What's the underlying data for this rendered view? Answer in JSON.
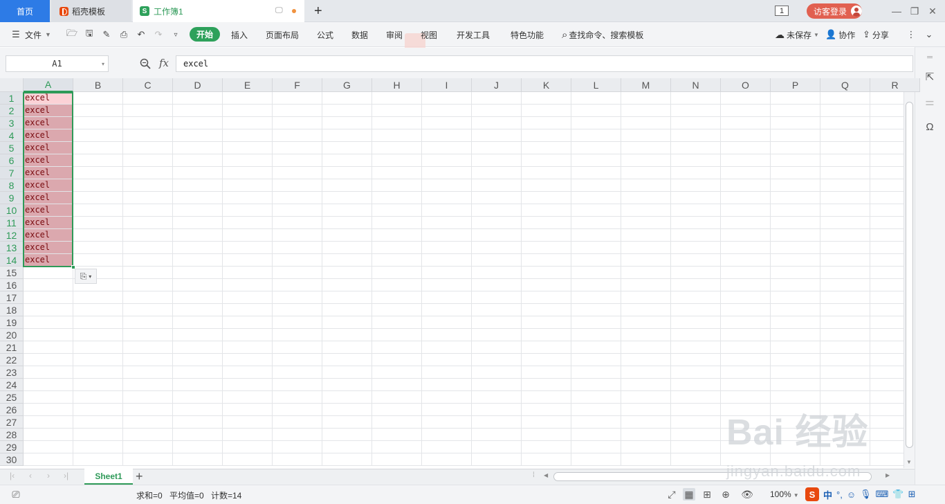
{
  "titlebar": {
    "tabs": [
      {
        "label": "首页"
      },
      {
        "label": "稻壳模板"
      },
      {
        "label": "工作簿1"
      }
    ],
    "window_count": "1",
    "login_label": "访客登录"
  },
  "menubar": {
    "file_label": "文件",
    "start_label": "开始",
    "items": [
      "插入",
      "页面布局",
      "公式",
      "数据",
      "审阅",
      "视图",
      "开发工具",
      "特色功能"
    ],
    "search_label": "查找命令、搜索模板",
    "unsaved_label": "未保存",
    "collab_label": "协作",
    "share_label": "分享"
  },
  "formulabar": {
    "name_box": "A1",
    "fx_label": "fx",
    "formula": "excel"
  },
  "grid": {
    "columns": [
      "A",
      "B",
      "C",
      "D",
      "E",
      "F",
      "G",
      "H",
      "I",
      "J",
      "K",
      "L",
      "M",
      "N",
      "O",
      "P",
      "Q",
      "R"
    ],
    "rows": [
      "1",
      "2",
      "3",
      "4",
      "5",
      "6",
      "7",
      "8",
      "9",
      "10",
      "11",
      "12",
      "13",
      "14",
      "15",
      "16",
      "17",
      "18",
      "19",
      "20",
      "21",
      "22",
      "23",
      "24",
      "25",
      "26",
      "27",
      "28",
      "29",
      "30"
    ],
    "col_a_values": [
      "excel",
      "excel",
      "excel",
      "excel",
      "excel",
      "excel",
      "excel",
      "excel",
      "excel",
      "excel",
      "excel",
      "excel",
      "excel",
      "excel"
    ]
  },
  "sheets": {
    "active": "Sheet1"
  },
  "statusbar": {
    "sum": "求和=0",
    "avg": "平均值=0",
    "count": "计数=14",
    "zoom": "100%"
  },
  "ime": {
    "logo": "S",
    "lang": "中"
  },
  "watermark": {
    "brand": "Bai 经验",
    "url": "jingyan.baidu.com"
  },
  "colors": {
    "accent": "#2ea15b",
    "home_tab": "#2d7be6",
    "login": "#e16050",
    "selection_fill": "#dba8ae"
  }
}
